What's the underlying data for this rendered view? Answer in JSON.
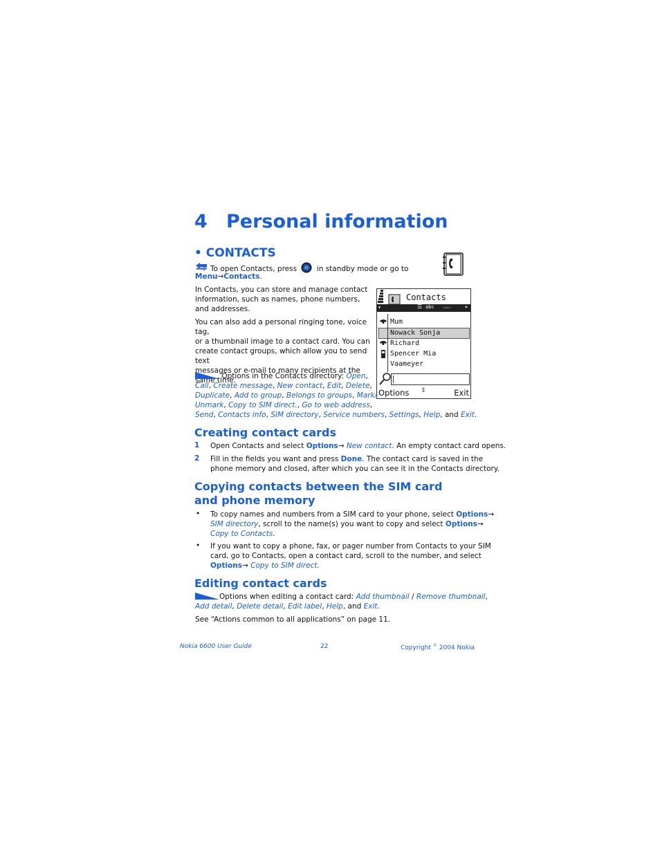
{
  "chapter": {
    "number": "4",
    "title": "Personal information"
  },
  "contacts_section": {
    "heading": "• CONTACTS",
    "shortcut": {
      "before": "To open Contacts, press",
      "after": "in standby mode or go to",
      "menu": "Menu",
      "arrow": "→",
      "target": "Contacts",
      "end": "."
    },
    "para1": [
      "In Contacts, you can store and manage contact",
      "information, such as names, phone numbers,",
      "and addresses."
    ],
    "para2": [
      "You can also add a personal ringing tone, voice tag,",
      "or a thumbnail image to a contact card. You can",
      "create contact groups, which allow you to send text",
      "messages or e-mail to many recipients at the",
      "same time."
    ],
    "options_intro": "Options in the Contacts directory:",
    "options_list": [
      "Open",
      "Call",
      "Create message",
      "New contact",
      "Edit",
      "Delete",
      "Duplicate",
      "Add to group",
      "Belongs to groups",
      "Mark/ Unmark",
      "Copy to SIM direct.",
      "Go to web address",
      "Send",
      "Contacts info",
      "SIM directory",
      "Service numbers",
      "Settings",
      "Help",
      "Exit"
    ],
    "and_word": "and"
  },
  "phone_screen": {
    "title": "Contacts",
    "tab_text": "abc",
    "contacts": [
      "Mum",
      "Nowack Sonja",
      "Richard",
      "Spencer Mia",
      "Vaameyer"
    ],
    "left_softkey": "Options",
    "right_softkey": "Exit"
  },
  "creating": {
    "heading": "Creating contact cards",
    "step1": {
      "num": "1",
      "pre": "Open Contacts and select",
      "options": "Options",
      "arrow": "→",
      "item": "New contact",
      "post": ". An empty contact card opens."
    },
    "step2": {
      "num": "2",
      "pre": "Fill in the fields you want and press",
      "done": "Done",
      "post1": ". The contact card is saved in the",
      "post2": "phone memory and closed, after which you can see it in the Contacts directory."
    }
  },
  "copying": {
    "heading_line1": "Copying contacts between the SIM card",
    "heading_line2": "and phone memory",
    "bullet1": {
      "pre": "To copy names and numbers from a SIM card to your phone, select",
      "options": "Options",
      "arrow": "→",
      "sim_dir": "SIM directory",
      "mid": ", scroll to the name(s) you want to copy and select",
      "options2": "Options",
      "copy": "Copy to Contacts",
      "end": "."
    },
    "bullet2": {
      "line1": "If you want to copy a phone, fax, or pager number from Contacts to your SIM",
      "line2": "card, go to Contacts, open a contact card, scroll to the number, and select",
      "options": "Options",
      "arrow": "→",
      "copy": "Copy to SIM direct."
    }
  },
  "editing": {
    "heading": "Editing contact cards",
    "intro": "Options when editing a contact card:",
    "options": [
      "Add thumbnail",
      "Remove thumbnail",
      "Add detail",
      "Delete detail",
      "Edit label",
      "Help",
      "Exit"
    ],
    "slash": "/",
    "and_word": "and",
    "see_also": "See “Actions common to all applications” on page 11."
  },
  "footer": {
    "left": "Nokia 6600 User Guide",
    "page": "22",
    "right_pre": "Copyright",
    "right_sym": "©",
    "right_post": "2004 Nokia"
  }
}
